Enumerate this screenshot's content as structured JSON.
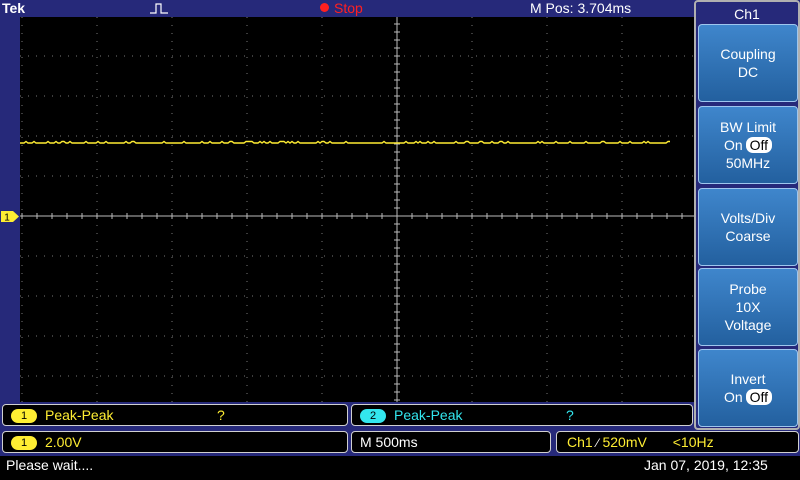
{
  "header": {
    "brand": "Tek",
    "run_state": "Stop",
    "m_pos": "M Pos: 3.704ms",
    "trigger_icon": "pulse-trigger-icon"
  },
  "colors": {
    "ch1": "#ffee33",
    "ch2": "#33e6ee",
    "stop": "#ff2020",
    "menu_button": "#2e6fb0",
    "background": "#26297a"
  },
  "channel_marker": "1",
  "side_menu": {
    "title": "Ch1",
    "buttons": [
      {
        "line1": "Coupling",
        "line2": "DC"
      },
      {
        "line1": "BW Limit",
        "line2_label": "On",
        "line2_toggle": "Off",
        "line3": "50MHz"
      },
      {
        "line1": "Volts/Div",
        "line2": "Coarse"
      },
      {
        "line1": "Probe",
        "line2": "10X",
        "line3": "Voltage"
      },
      {
        "line1": "Invert",
        "line2_label": "On",
        "line2_toggle": "Off"
      }
    ]
  },
  "measurements": [
    {
      "channel": "1",
      "label": "Peak-Peak",
      "value": "?"
    },
    {
      "channel": "2",
      "label": "Peak-Peak",
      "value": "?"
    }
  ],
  "settings": {
    "ch1_channel": "1",
    "ch1_scale": "2.00V",
    "timebase": "M 500ms",
    "trigger_source": "Ch1",
    "trigger_slope": "⁄",
    "trigger_level": "520mV",
    "trigger_freq": "<10Hz"
  },
  "status": {
    "message": "Please wait....",
    "datetime": "Jan 07, 2019, 12:35"
  }
}
